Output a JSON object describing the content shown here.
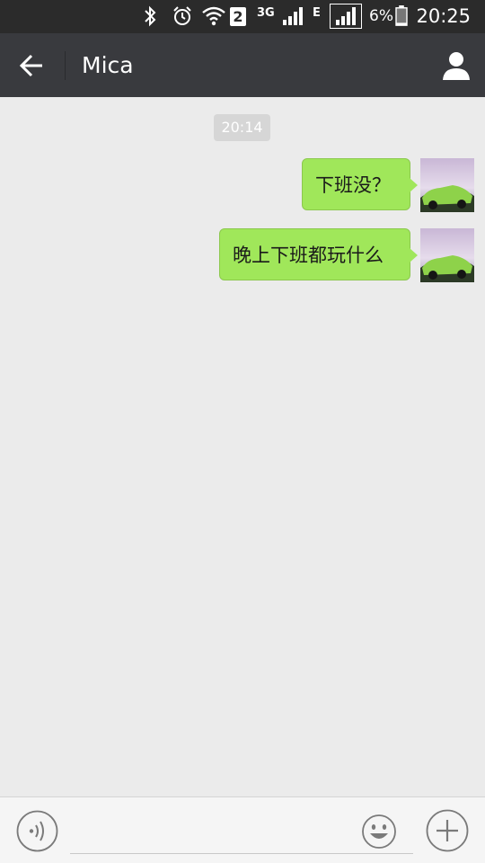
{
  "status_bar": {
    "sim_slot": "2",
    "network_3g": "3G",
    "network_e": "E",
    "battery_percent": "6%",
    "time": "20:25"
  },
  "header": {
    "title": "Mica"
  },
  "chat": {
    "timestamp": "20:14",
    "messages": [
      {
        "text": "下班没？"
      },
      {
        "text": "晚上下班都玩什么"
      }
    ]
  },
  "input": {
    "value": "",
    "placeholder": ""
  }
}
